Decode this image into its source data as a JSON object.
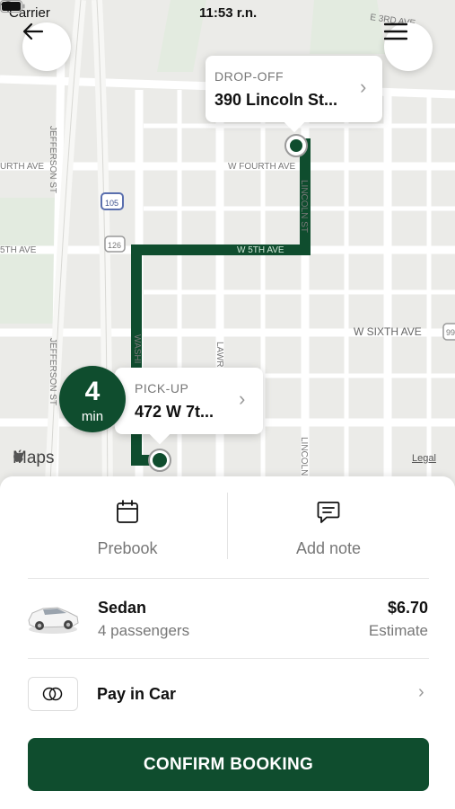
{
  "status_bar": {
    "carrier": "Carrier",
    "time": "11:53 r.n."
  },
  "map": {
    "street_labels": [
      "E 3RD AVE",
      "JEFFERSON ST",
      "URTH AVE",
      "W FOURTH AVE",
      "LINCOLN ST",
      "105",
      "126",
      "5TH AVE",
      "W 5TH AVE",
      "W SIXTH AVE",
      "WASHI",
      "LAWR",
      "JEFFERSON ST",
      "LINCOLN",
      "99"
    ],
    "route_color": "#0f4d2e"
  },
  "dropoff": {
    "label": "DROP-OFF",
    "address": "390 Lincoln St..."
  },
  "pickup": {
    "label": "PICK-UP",
    "address": "472 W 7t...",
    "eta_value": "4",
    "eta_unit": "min"
  },
  "map_attribution": {
    "logo": "Maps",
    "legal": "Legal"
  },
  "sheet": {
    "actions": [
      {
        "label": "Prebook",
        "icon": "calendar-icon"
      },
      {
        "label": "Add note",
        "icon": "note-icon"
      }
    ],
    "vehicle": {
      "name": "Sedan",
      "capacity": "4 passengers",
      "price": "$6.70",
      "price_note": "Estimate"
    },
    "payment": {
      "label": "Pay in Car",
      "icon": "cash-icon"
    },
    "confirm_label": "CONFIRM BOOKING"
  },
  "colors": {
    "brand": "#0f4d2e",
    "map_bg": "#ececea"
  }
}
